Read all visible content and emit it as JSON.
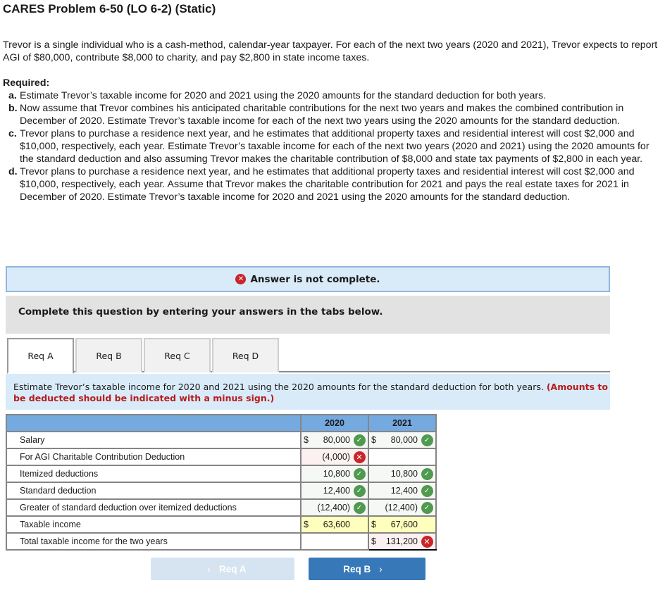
{
  "title": "CARES Problem 6-50 (LO 6-2) (Static)",
  "intro": "Trevor is a single individual who is a cash-method, calendar-year taxpayer. For each of the next two years (2020 and 2021), Trevor expects to report AGI of $80,000, contribute $8,000 to charity, and pay $2,800 in state income taxes.",
  "required": {
    "heading": "Required:",
    "items": [
      {
        "label": "a.",
        "text": "Estimate Trevor’s taxable income for 2020 and 2021 using the 2020 amounts for the standard deduction for both years."
      },
      {
        "label": "b.",
        "text": "Now assume that Trevor combines his anticipated charitable contributions for the next two years and makes the combined contribution in December of 2020. Estimate Trevor’s taxable income for each of the next two years using the 2020 amounts for the standard deduction."
      },
      {
        "label": "c.",
        "text": "Trevor plans to purchase a residence next year, and he estimates that additional property taxes and residential interest will cost $2,000 and $10,000, respectively, each year. Estimate Trevor’s taxable income for each of the next two years (2020 and 2021) using the 2020 amounts for the standard deduction and also assuming Trevor makes the charitable contribution of $8,000 and state tax payments of $2,800 in each year."
      },
      {
        "label": "d.",
        "text": "Trevor plans to purchase a residence next year, and he estimates that additional property taxes and residential interest will cost $2,000 and $10,000, respectively, each year. Assume that Trevor makes the charitable contribution for 2021 and pays the real estate taxes for 2021 in December of 2020. Estimate Trevor’s taxable income for 2020 and 2021 using the 2020 amounts for the standard deduction."
      }
    ]
  },
  "banner": {
    "icon": "x-circle-icon",
    "text": "Answer is not complete."
  },
  "instructions": "Complete this question by entering your answers in the tabs below.",
  "tabs": [
    {
      "label": "Req A",
      "active": true
    },
    {
      "label": "Req B",
      "active": false
    },
    {
      "label": "Req C",
      "active": false
    },
    {
      "label": "Req D",
      "active": false
    }
  ],
  "task": {
    "text": "Estimate Trevor’s taxable income for 2020 and 2021 using the 2020 amounts for the standard deduction for both years.",
    "note": "(Amounts to be deducted should be indicated with a minus sign.)"
  },
  "table": {
    "headers": [
      "",
      "2020",
      "2021"
    ],
    "rows": [
      {
        "label": "Salary",
        "c2020": {
          "dollar": "$",
          "value": "80,000",
          "status": "correct"
        },
        "c2021": {
          "dollar": "$",
          "value": "80,000",
          "status": "correct"
        }
      },
      {
        "label": "For AGI Charitable Contribution Deduction",
        "c2020": {
          "dollar": "",
          "value": "(4,000)",
          "status": "incorrect"
        },
        "c2021": {
          "dollar": "",
          "value": "",
          "status": "blank"
        }
      },
      {
        "label": "Itemized deductions",
        "c2020": {
          "dollar": "",
          "value": "10,800",
          "status": "correct"
        },
        "c2021": {
          "dollar": "",
          "value": "10,800",
          "status": "correct"
        }
      },
      {
        "label": "Standard deduction",
        "c2020": {
          "dollar": "",
          "value": "12,400",
          "status": "correct"
        },
        "c2021": {
          "dollar": "",
          "value": "12,400",
          "status": "correct"
        }
      },
      {
        "label": "Greater of standard deduction over itemized deductions",
        "c2020": {
          "dollar": "",
          "value": "(12,400)",
          "status": "correct"
        },
        "c2021": {
          "dollar": "",
          "value": "(12,400)",
          "status": "correct"
        }
      },
      {
        "label": "Taxable income",
        "c2020": {
          "dollar": "$",
          "value": "63,600",
          "status": "computed"
        },
        "c2021": {
          "dollar": "$",
          "value": "67,600",
          "status": "computed"
        }
      },
      {
        "label": "Total taxable income for the two years",
        "c2021": {
          "dollar": "$",
          "value": "131,200",
          "status": "incorrect"
        }
      }
    ]
  },
  "nav": {
    "prev_label": "Req A",
    "next_label": "Req B",
    "prev_chevron": "‹",
    "next_chevron": "›"
  },
  "colors": {
    "correct": "#4f9a4f",
    "incorrect": "#c8262c",
    "header": "#74aadf",
    "computed": "#ffffbd",
    "next_button": "#3778b8",
    "prev_button_disabled": "#d6e4f1"
  }
}
